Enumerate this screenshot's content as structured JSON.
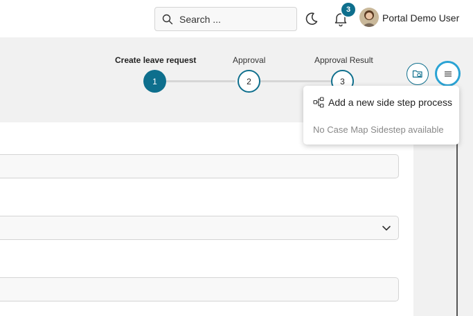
{
  "header": {
    "search_placeholder": "Search ...",
    "notification_count": "3",
    "user_name": "Portal Demo User"
  },
  "stepper": {
    "steps": [
      {
        "label": "Create leave request",
        "number": "1",
        "state": "active"
      },
      {
        "label": "Approval",
        "number": "2",
        "state": "inactive"
      },
      {
        "label": "Approval Result",
        "number": "3",
        "state": "inactive"
      }
    ]
  },
  "menu": {
    "items": [
      {
        "label": "Add a new side step process",
        "icon": "side-step-icon"
      }
    ],
    "empty_note": "No Case Map Sidestep available"
  },
  "colors": {
    "accent": "#0e6f8d",
    "focus_ring": "#2aa3d4"
  }
}
